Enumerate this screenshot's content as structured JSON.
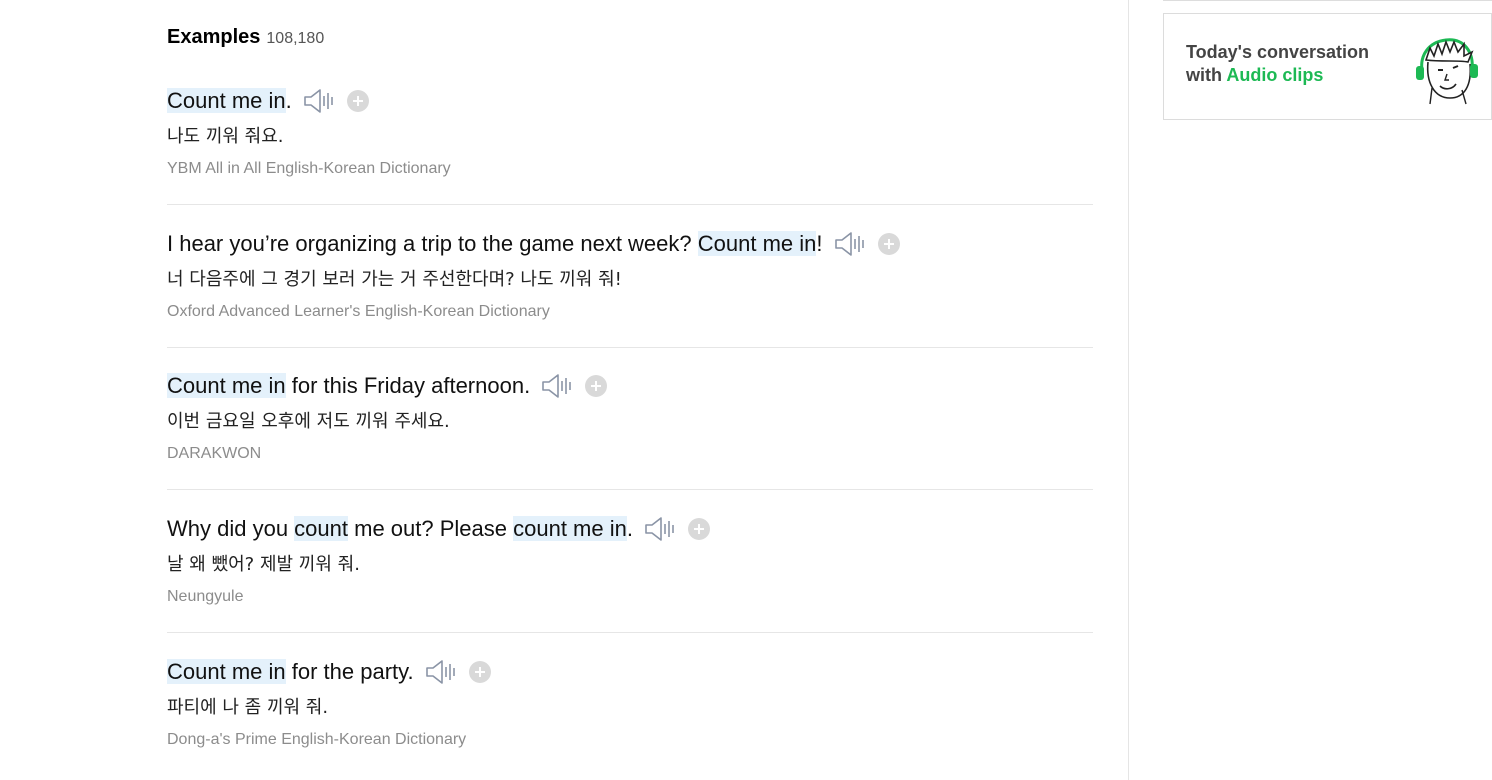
{
  "examples": {
    "title": "Examples",
    "count": "108,180",
    "items": [
      {
        "parts": [
          {
            "text": "Count me in",
            "highlight": true
          },
          {
            "text": ".",
            "highlight": false
          }
        ],
        "translation": "나도 끼워 줘요.",
        "source": "YBM All in All English-Korean Dictionary"
      },
      {
        "parts": [
          {
            "text": "I hear you’re organizing a trip to the game next week? ",
            "highlight": false
          },
          {
            "text": "Count me in",
            "highlight": true
          },
          {
            "text": "!",
            "highlight": false
          }
        ],
        "translation": "너 다음주에 그 경기 보러 가는 거 주선한다며? 나도 끼워 줘!",
        "source": "Oxford Advanced Learner's English-Korean Dictionary"
      },
      {
        "parts": [
          {
            "text": "Count me in",
            "highlight": true
          },
          {
            "text": " for this Friday afternoon.",
            "highlight": false
          }
        ],
        "translation": "이번 금요일 오후에 저도 끼워 주세요.",
        "source": "DARAKWON"
      },
      {
        "parts": [
          {
            "text": "Why did you ",
            "highlight": false
          },
          {
            "text": "count",
            "highlight": true
          },
          {
            "text": " me out? Please ",
            "highlight": false
          },
          {
            "text": "count me in",
            "highlight": true
          },
          {
            "text": ".",
            "highlight": false
          }
        ],
        "translation": "날 왜 뺐어? 제발 끼워 줘.",
        "source": "Neungyule"
      },
      {
        "parts": [
          {
            "text": "Count me in",
            "highlight": true
          },
          {
            "text": " for the party.",
            "highlight": false
          }
        ],
        "translation": "파티에 나 좀 끼워 줘.",
        "source": "Dong-a's Prime English-Korean Dictionary"
      }
    ]
  },
  "sidebar": {
    "promo": {
      "line1": "Today's conversation",
      "line2_prefix": "with ",
      "line2_accent": "Audio clips",
      "accent_color": "#1db954",
      "image_icon": "headphones-face-icon"
    }
  },
  "icons": {
    "speaker": "speaker-icon",
    "add": "plus-circle-icon"
  }
}
